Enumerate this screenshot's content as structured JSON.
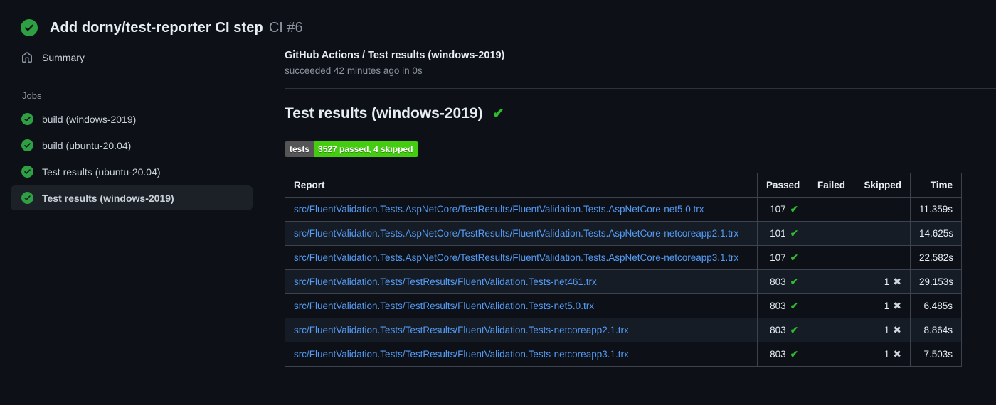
{
  "header": {
    "status_icon": "check-circle-icon",
    "title": "Add dorny/test-reporter CI step",
    "run_label": "CI #6"
  },
  "sidebar": {
    "summary": {
      "icon": "home-icon",
      "label": "Summary"
    },
    "jobs_heading": "Jobs",
    "jobs": [
      {
        "label": "build (windows-2019)",
        "status": "success",
        "selected": false
      },
      {
        "label": "build (ubuntu-20.04)",
        "status": "success",
        "selected": false
      },
      {
        "label": "Test results (ubuntu-20.04)",
        "status": "success",
        "selected": false
      },
      {
        "label": "Test results (windows-2019)",
        "status": "success",
        "selected": true
      }
    ]
  },
  "main": {
    "check_run": {
      "title": "GitHub Actions / Test results (windows-2019)",
      "status_line": "succeeded 42 minutes ago in 0s"
    },
    "section": {
      "title": "Test results (windows-2019)",
      "status_icon": "check-icon"
    },
    "badge": {
      "label": "tests",
      "value": "3527 passed, 4 skipped"
    },
    "table": {
      "columns": [
        "Report",
        "Passed",
        "Failed",
        "Skipped",
        "Time"
      ],
      "rows": [
        {
          "report": "src/FluentValidation.Tests.AspNetCore/TestResults/FluentValidation.Tests.AspNetCore-net5.0.trx",
          "passed": "107",
          "failed": "",
          "skipped": "",
          "time": "11.359s"
        },
        {
          "report": "src/FluentValidation.Tests.AspNetCore/TestResults/FluentValidation.Tests.AspNetCore-netcoreapp2.1.trx",
          "passed": "101",
          "failed": "",
          "skipped": "",
          "time": "14.625s"
        },
        {
          "report": "src/FluentValidation.Tests.AspNetCore/TestResults/FluentValidation.Tests.AspNetCore-netcoreapp3.1.trx",
          "passed": "107",
          "failed": "",
          "skipped": "",
          "time": "22.582s"
        },
        {
          "report": "src/FluentValidation.Tests/TestResults/FluentValidation.Tests-net461.trx",
          "passed": "803",
          "failed": "",
          "skipped": "1",
          "time": "29.153s"
        },
        {
          "report": "src/FluentValidation.Tests/TestResults/FluentValidation.Tests-net5.0.trx",
          "passed": "803",
          "failed": "",
          "skipped": "1",
          "time": "6.485s"
        },
        {
          "report": "src/FluentValidation.Tests/TestResults/FluentValidation.Tests-netcoreapp2.1.trx",
          "passed": "803",
          "failed": "",
          "skipped": "1",
          "time": "8.864s"
        },
        {
          "report": "src/FluentValidation.Tests/TestResults/FluentValidation.Tests-netcoreapp3.1.trx",
          "passed": "803",
          "failed": "",
          "skipped": "1",
          "time": "7.503s"
        }
      ]
    }
  },
  "icons": {
    "passed_glyph": "✔",
    "skipped_glyph": "✖"
  },
  "colors": {
    "page_bg": "#0d1117",
    "accent_green": "#2ea043",
    "check_green": "#2ebc2e",
    "link_blue": "#539bf5",
    "badge_label_bg": "#555555",
    "badge_value_bg": "#44cc11",
    "selected_item_bg": "#1c2128",
    "table_border": "#3c434d",
    "row_alt_bg": "#161c26"
  }
}
